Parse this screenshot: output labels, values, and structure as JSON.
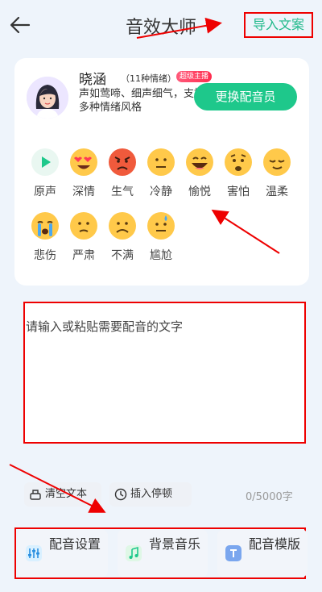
{
  "header": {
    "title": "音效大师",
    "import_label": "导入文案"
  },
  "voice": {
    "name": "晓涵",
    "emotion_count": "（11种情绪）",
    "badge": "超级主播",
    "description": "声如莺啼、细声细气，支持多种情绪风格",
    "change_button": "更换配音员"
  },
  "emotions": [
    {
      "label": "原声",
      "icon": "play-icon"
    },
    {
      "label": "深情",
      "icon": "heart-eyes-icon"
    },
    {
      "label": "生气",
      "icon": "angry-face-icon"
    },
    {
      "label": "冷静",
      "icon": "neutral-face-icon"
    },
    {
      "label": "愉悦",
      "icon": "grin-face-icon"
    },
    {
      "label": "害怕",
      "icon": "worried-face-icon"
    },
    {
      "label": "温柔",
      "icon": "relieved-face-icon"
    },
    {
      "label": "悲伤",
      "icon": "crying-face-icon"
    },
    {
      "label": "严肃",
      "icon": "serious-face-icon"
    },
    {
      "label": "不满",
      "icon": "frown-face-icon"
    },
    {
      "label": "尴尬",
      "icon": "awkward-face-icon"
    }
  ],
  "editor": {
    "placeholder": "请输入或粘贴需要配音的文字",
    "clear_label": "清空文本",
    "pause_label": "插入停顿",
    "count": "0/5000字"
  },
  "bottom": {
    "settings_label": "配音设置",
    "music_label": "背景音乐",
    "template_label": "配音模版"
  },
  "colors": {
    "accent": "#1ec88b",
    "annotation": "#e00000"
  }
}
